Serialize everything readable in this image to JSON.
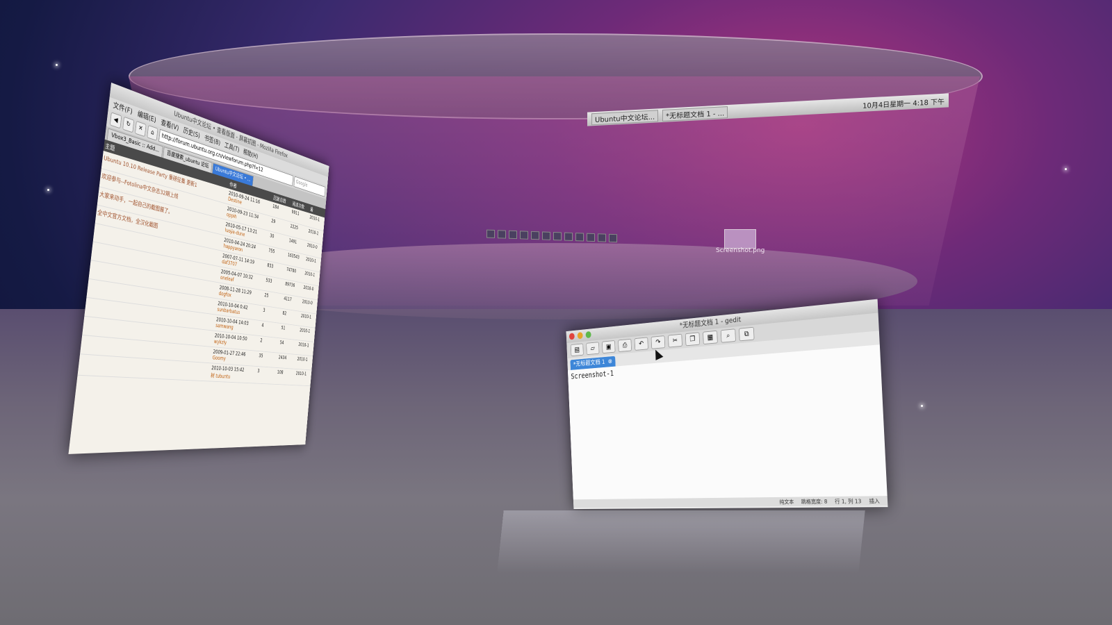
{
  "desktop": {
    "panel_tasks": [
      "Ubuntu中文论坛...",
      "*无标题文档 1 - ..."
    ],
    "clock": "10月4日星期一 4:18 下午",
    "desktop_icon_label": "Screenshot.png"
  },
  "firefox": {
    "title": "Ubuntu中文论坛 • 查看版面 - 屏幕抓图 - Mozilla Firefox",
    "menu": [
      "文件(F)",
      "编辑(E)",
      "查看(V)",
      "历史(S)",
      "书签(B)",
      "工具(T)",
      "帮助(H)"
    ],
    "url": "http://forum.ubuntu.org.cn/viewforum.php?f=12",
    "search_placeholder": "Google",
    "tabs": [
      "Vbox3_Basic :: Add...",
      "百度搜索_ubuntu 论坛",
      "Ubuntu中文论坛 • ..."
    ],
    "columns": [
      "主题",
      "作者",
      "回复总数",
      "阅读次数",
      "最"
    ],
    "rows": [
      {
        "topic": "Ubuntu 10.10 Release Party 重磅征集 更新1",
        "date": "2010-09-24 11:16",
        "author": "Destine",
        "replies": "184",
        "views": "9911",
        "last": "2010-1"
      },
      {
        "topic": "欢迎参与--Fotolina中文杂志32期上线",
        "date": "2010-09-23 11:34",
        "author": "oppih",
        "replies": "29",
        "views": "2225",
        "last": "2010-1"
      },
      {
        "topic": "大家来动手，一起自己的截图展了。",
        "date": "2010-05-17 13:21",
        "author": "luojie-dune",
        "replies": "30",
        "views": "1491",
        "last": "2010-0"
      },
      {
        "topic": "全中文官方文档，全汉化截图",
        "date": "2010-04-24 20:24",
        "author": "happyaron",
        "replies": "755",
        "views": "163543",
        "last": "2010-1"
      },
      {
        "topic": "",
        "date": "2007-07-11 14:19",
        "author": "daf3707",
        "replies": "833",
        "views": "74780",
        "last": "2010-1"
      },
      {
        "topic": "",
        "date": "2005-04-07 10:32",
        "author": "oneleaf",
        "replies": "533",
        "views": "89736",
        "last": "2010-0"
      },
      {
        "topic": "",
        "date": "2008-11-28 11:29",
        "author": "dogfox",
        "replies": "25",
        "views": "4117",
        "last": "2010-0"
      },
      {
        "topic": "",
        "date": "2010-10-04 0:42",
        "author": "sunbarbatus",
        "replies": "3",
        "views": "82",
        "last": "2010-1"
      },
      {
        "topic": "",
        "date": "2010-10-04 14:03",
        "author": "samwang",
        "replies": "4",
        "views": "51",
        "last": "2010-1"
      },
      {
        "topic": "",
        "date": "2010-10-04 10:50",
        "author": "wykzly",
        "replies": "2",
        "views": "54",
        "last": "2010-1"
      },
      {
        "topic": "",
        "date": "2009-01-27 22:46",
        "author": "Goomy",
        "replies": "35",
        "views": "2434",
        "last": "2010-1"
      },
      {
        "topic": "",
        "date": "2010-10-03 15:42",
        "author": "树 tubuntu",
        "replies": "3",
        "views": "108",
        "last": "2010-1"
      }
    ]
  },
  "gedit": {
    "title": "*无标题文档 1 - gedit",
    "tab_label": "*无标题文档 1",
    "content": "Screenshot-1",
    "status": [
      "纯文本",
      "跳格宽度: 8",
      "行 1, 列 13",
      "插入"
    ]
  }
}
